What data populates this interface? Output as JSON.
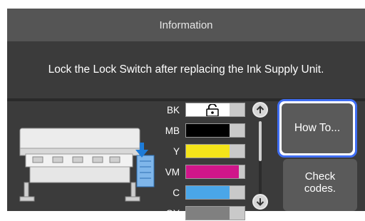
{
  "header": {
    "title": "Information"
  },
  "message": {
    "text": "Lock the Lock Switch after replacing the Ink Supply Unit."
  },
  "inks": [
    {
      "name": "BK",
      "color": "#ffffff",
      "level": 0.74,
      "locked": true
    },
    {
      "name": "MB",
      "color": "#000000",
      "level": 0.74,
      "locked": false
    },
    {
      "name": "Y",
      "color": "#f4e41a",
      "level": 0.74,
      "locked": false
    },
    {
      "name": "VM",
      "color": "#d0168a",
      "level": 0.9,
      "locked": false
    },
    {
      "name": "C",
      "color": "#4aa6e8",
      "level": 0.74,
      "locked": false
    },
    {
      "name": "GY",
      "color": "#808080",
      "level": 0.74,
      "locked": false
    }
  ],
  "icons": {
    "lock": "lock-open-icon",
    "scroll_up": "arrow-up-icon",
    "scroll_down": "arrow-down-icon",
    "printer": "printer-illustration",
    "replace_arrow": "arrow-down-indicator-icon"
  },
  "buttons": {
    "how_to": "How To...",
    "check_codes": "Check\ncodes."
  },
  "colors": {
    "accent": "#3f6df2",
    "indicator": "#1e7cd8"
  }
}
